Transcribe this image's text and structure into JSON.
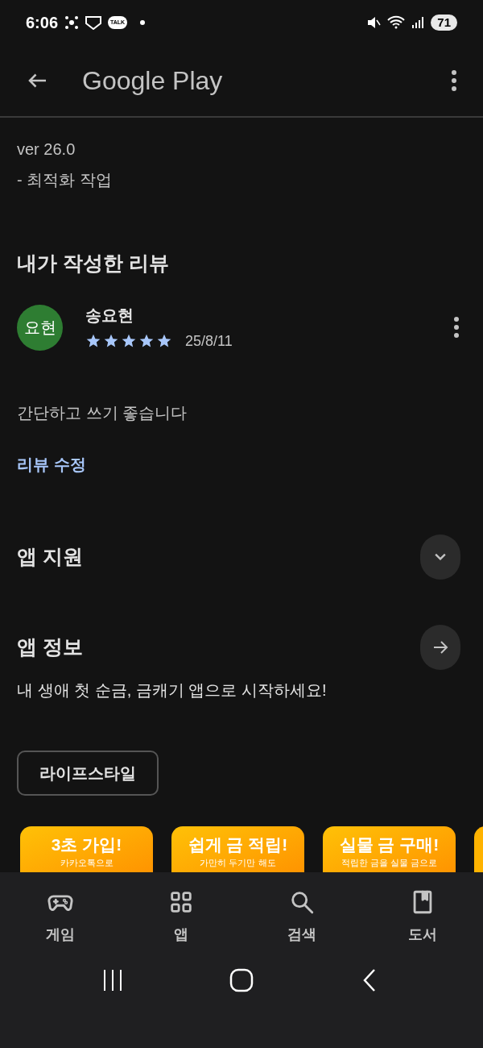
{
  "status_bar": {
    "time": "6:06",
    "notif_talk": "TALK",
    "battery": "71"
  },
  "header": {
    "title": "Google Play"
  },
  "whats_new": {
    "version": "ver 26.0",
    "notes": "- 최적화 작업"
  },
  "my_review": {
    "heading": "내가 작성한 리뷰",
    "avatar": "요현",
    "author": "송요현",
    "stars": 5,
    "date": "25/8/11",
    "text": "간단하고 쓰기 좋습니다",
    "edit_link": "리뷰 수정"
  },
  "sections": [
    {
      "kind": "expand",
      "title": "앱 지원"
    },
    {
      "kind": "arrow",
      "title": "앱 정보"
    }
  ],
  "description": "내 생애 첫 순금, 금캐기 앱으로 시작하세요!",
  "category_chip": "라이프스타일",
  "screenshots": [
    {
      "title": "3초 가입!",
      "subtitle": "카카오톡으로"
    },
    {
      "title": "쉽게 금 적립!",
      "subtitle": "가만히 두기만 해도"
    },
    {
      "title": "실물 금 구매!",
      "subtitle": "적립한 금을 실물 금으로"
    }
  ],
  "bottom_nav": [
    {
      "kind": "games",
      "label": "게임"
    },
    {
      "kind": "apps",
      "label": "앱"
    },
    {
      "kind": "search",
      "label": "검색"
    },
    {
      "kind": "books",
      "label": "도서"
    }
  ]
}
